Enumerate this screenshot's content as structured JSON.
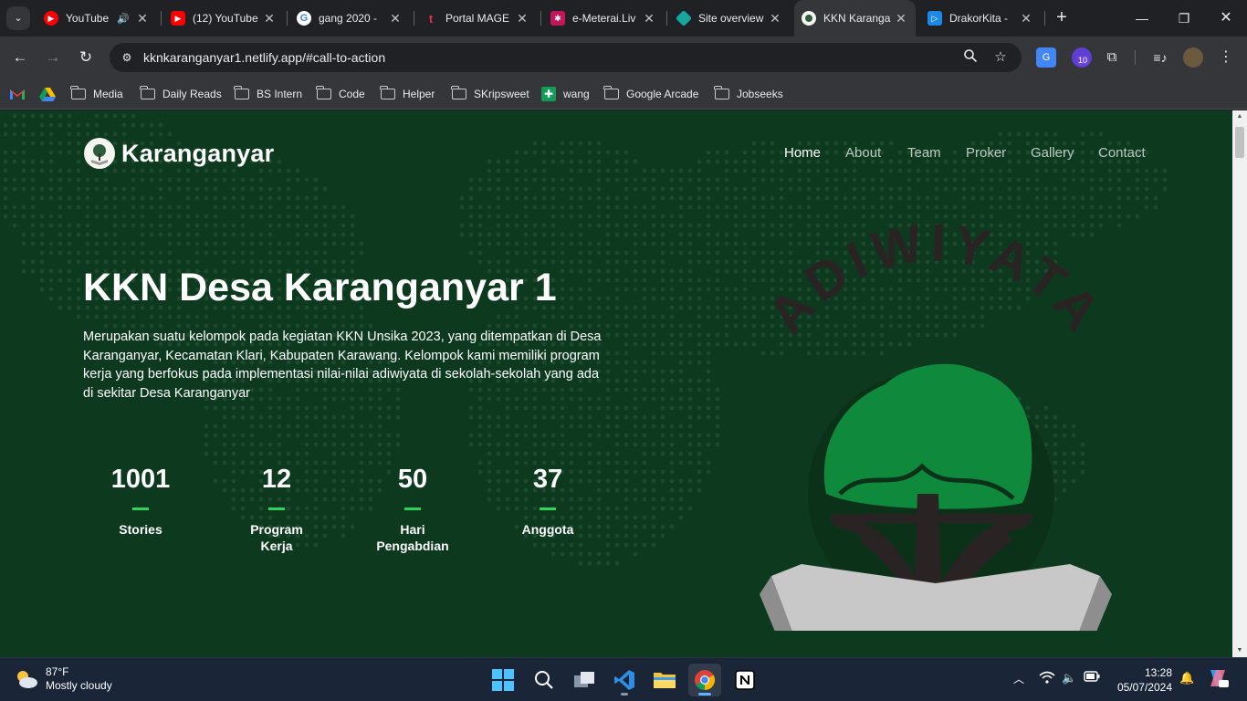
{
  "browser": {
    "tabs": [
      {
        "title": "YouTube",
        "audio": true
      },
      {
        "title": "(12) YouTube"
      },
      {
        "title": "gang 2020 -"
      },
      {
        "title": "Portal MAGE"
      },
      {
        "title": "e-Meterai.Liv"
      },
      {
        "title": "Site overview"
      },
      {
        "title": "KKN Karanga",
        "active": true
      },
      {
        "title": "DrakorKita -"
      }
    ],
    "url": "kknkaranganyar1.netlify.app/#call-to-action",
    "extension_badge": "10",
    "bookmarks": [
      {
        "label": "Media",
        "icon": "folder-icon"
      },
      {
        "label": "Daily Reads",
        "icon": "folder-icon"
      },
      {
        "label": "BS Intern",
        "icon": "folder-icon"
      },
      {
        "label": "Code",
        "icon": "folder-icon"
      },
      {
        "label": "Helper",
        "icon": "folder-icon"
      },
      {
        "label": "SKripsweet",
        "icon": "folder-icon"
      },
      {
        "label": "wang",
        "icon": "bookmark-icon"
      },
      {
        "label": "Google Arcade",
        "icon": "folder-icon"
      },
      {
        "label": "Jobseeks",
        "icon": "folder-icon"
      }
    ]
  },
  "site": {
    "brand": "Karanganyar",
    "nav": [
      "Home",
      "About",
      "Team",
      "Proker",
      "Gallery",
      "Contact"
    ],
    "hero_title": "KKN Desa Karanganyar 1",
    "hero_description": "Merupakan suatu kelompok pada kegiatan KKN Unsika 2023, yang ditempatkan di Desa Karanganyar, Kecamatan Klari, Kabupaten Karawang. Kelompok kami memiliki program kerja yang berfokus pada implementasi nilai-nilai adiwiyata di sekolah-sekolah yang ada di sekitar Desa Karanganyar",
    "stats": [
      {
        "value": "1001",
        "label": "Stories"
      },
      {
        "value": "12",
        "label": "Program Kerja"
      },
      {
        "value": "50",
        "label": "Hari Pengabdian"
      },
      {
        "value": "37",
        "label": "Anggota"
      }
    ],
    "emblem_text": "ADIWIYATA",
    "colors": {
      "background": "#0d3a1f",
      "accent": "#2ed35c",
      "tree": "#0f8a3d"
    }
  },
  "taskbar": {
    "weather_temp": "87°F",
    "weather_desc": "Mostly cloudy",
    "time": "13:28",
    "date": "05/07/2024"
  }
}
